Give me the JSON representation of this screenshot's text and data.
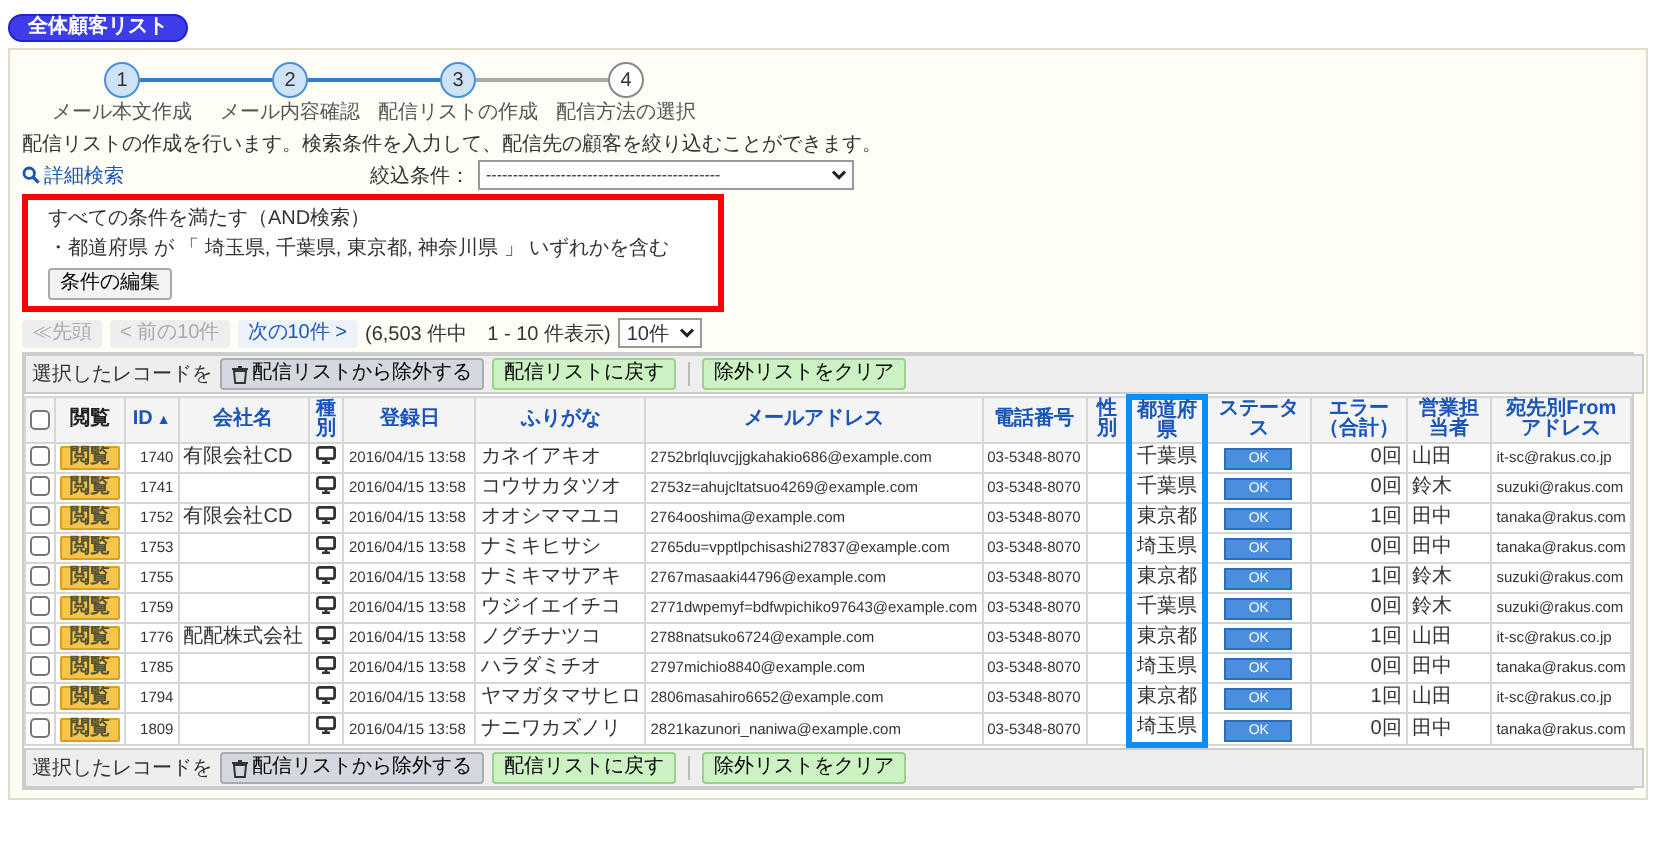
{
  "title": "全体顧客リスト",
  "steps": [
    {
      "number": "1",
      "label": "メール本文作成",
      "reached": true
    },
    {
      "number": "2",
      "label": "メール内容確認",
      "reached": true
    },
    {
      "number": "3",
      "label": "配信リストの作成",
      "reached": true
    },
    {
      "number": "4",
      "label": "配信方法の選択",
      "reached": false
    }
  ],
  "description": "配信リストの作成を行います。検索条件を入力して、配信先の顧客を絞り込むことができます。",
  "advanced_search": "詳細検索",
  "filter": {
    "label": "絞込条件：",
    "value": "--------------------------------------------"
  },
  "condition_box": {
    "lines": [
      "すべての条件を満たす（AND検索）",
      "・都道府県 が 「 埼玉県, 千葉県, 東京都, 神奈川県 」 いずれかを含む"
    ],
    "button": "条件の編集"
  },
  "pager": {
    "buttons": [
      {
        "label": "≪先頭",
        "disabled": true
      },
      {
        "label": "< 前の10件",
        "disabled": true
      },
      {
        "label": "次の10件 >",
        "disabled": false
      }
    ],
    "summary": "(6,503 件中　1 - 10 件表示)",
    "per_page": "10件"
  },
  "toolbar_top": {
    "label": "選択したレコードを",
    "buttons": [
      {
        "kind": "remove",
        "label": "配信リストから除外する",
        "separator_before": false
      },
      {
        "kind": "action",
        "label": "配信リストに戻す",
        "separator_before": false
      },
      {
        "kind": "action",
        "label": "除外リストをクリア",
        "separator_before": true
      }
    ]
  },
  "columns": [
    {
      "kind": "checkbox",
      "checked": false
    },
    {
      "kind": "view",
      "label": "閲覧",
      "link": false,
      "highlighted": false
    },
    {
      "kind": "id",
      "label": "ID",
      "sort_indicator": "▲",
      "link": true,
      "highlighted": false
    },
    {
      "kind": "company",
      "label": "会社名",
      "link": true,
      "highlighted": false
    },
    {
      "kind": "type",
      "label": "種別",
      "link": true,
      "highlighted": false
    },
    {
      "kind": "date",
      "label": "登録日",
      "link": true,
      "highlighted": false
    },
    {
      "kind": "furigana",
      "label": "ふりがな",
      "link": true,
      "highlighted": false
    },
    {
      "kind": "email",
      "label": "メールアドレス",
      "link": true,
      "highlighted": false
    },
    {
      "kind": "phone",
      "label": "電話番号",
      "link": true,
      "highlighted": false
    },
    {
      "kind": "gender",
      "label": "性別",
      "link": true,
      "highlighted": false
    },
    {
      "kind": "pref",
      "label": "都道府県",
      "link": true,
      "highlighted": true
    },
    {
      "kind": "status",
      "label": "ステータス",
      "link": true,
      "highlighted": false
    },
    {
      "kind": "errors",
      "label": "エラー（合計）",
      "link": true,
      "highlighted": false
    },
    {
      "kind": "sales",
      "label": "営業担当者",
      "link": true,
      "highlighted": false
    },
    {
      "kind": "from",
      "label": "宛先別Fromアドレス",
      "link": true,
      "highlighted": false
    }
  ],
  "rows": [
    {
      "checked": false,
      "view": "閲覧",
      "id": "1740",
      "company": "有限会社CD",
      "date": "2016/04/15 13:58",
      "furigana": "カネイアキオ",
      "email": "2752brlqluvcjjgkahakio686@example.com",
      "phone": "03-5348-8070",
      "pref": "千葉県",
      "status": "OK",
      "errors": "0回",
      "sales": "山田",
      "from": "it-sc@rakus.co.jp"
    },
    {
      "checked": false,
      "view": "閲覧",
      "id": "1741",
      "date": "2016/04/15 13:58",
      "furigana": "コウサカタツオ",
      "email": "2753z=ahujcltatsuo4269@example.com",
      "phone": "03-5348-8070",
      "pref": "千葉県",
      "status": "OK",
      "errors": "0回",
      "sales": "鈴木",
      "from": "suzuki@rakus.com"
    },
    {
      "checked": false,
      "view": "閲覧",
      "id": "1752",
      "company": "有限会社CD",
      "date": "2016/04/15 13:58",
      "furigana": "オオシママユコ",
      "email": "2764ooshima@example.com",
      "phone": "03-5348-8070",
      "pref": "東京都",
      "status": "OK",
      "errors": "1回",
      "sales": "田中",
      "from": "tanaka@rakus.com"
    },
    {
      "checked": false,
      "view": "閲覧",
      "id": "1753",
      "date": "2016/04/15 13:58",
      "furigana": "ナミキヒサシ",
      "email": "2765du=vpptlpchisashi27837@example.com",
      "phone": "03-5348-8070",
      "pref": "埼玉県",
      "status": "OK",
      "errors": "0回",
      "sales": "田中",
      "from": "tanaka@rakus.com"
    },
    {
      "checked": false,
      "view": "閲覧",
      "id": "1755",
      "date": "2016/04/15 13:58",
      "furigana": "ナミキマサアキ",
      "email": "2767masaaki44796@example.com",
      "phone": "03-5348-8070",
      "pref": "東京都",
      "status": "OK",
      "errors": "1回",
      "sales": "鈴木",
      "from": "suzuki@rakus.com"
    },
    {
      "checked": false,
      "view": "閲覧",
      "id": "1759",
      "date": "2016/04/15 13:58",
      "furigana": "ウジイエイチコ",
      "email": "2771dwpemyf=bdfwpichiko97643@example.com",
      "phone": "03-5348-8070",
      "pref": "千葉県",
      "status": "OK",
      "errors": "0回",
      "sales": "鈴木",
      "from": "suzuki@rakus.com"
    },
    {
      "checked": false,
      "view": "閲覧",
      "id": "1776",
      "company": "配配株式会社",
      "date": "2016/04/15 13:58",
      "furigana": "ノグチナツコ",
      "email": "2788natsuko6724@example.com",
      "phone": "03-5348-8070",
      "pref": "東京都",
      "status": "OK",
      "errors": "1回",
      "sales": "山田",
      "from": "it-sc@rakus.co.jp"
    },
    {
      "checked": false,
      "view": "閲覧",
      "id": "1785",
      "date": "2016/04/15 13:58",
      "furigana": "ハラダミチオ",
      "email": "2797michio8840@example.com",
      "phone": "03-5348-8070",
      "pref": "埼玉県",
      "status": "OK",
      "errors": "0回",
      "sales": "田中",
      "from": "tanaka@rakus.com"
    },
    {
      "checked": false,
      "view": "閲覧",
      "id": "1794",
      "date": "2016/04/15 13:58",
      "furigana": "ヤマガタマサヒロ",
      "email": "2806masahiro6652@example.com",
      "phone": "03-5348-8070",
      "pref": "東京都",
      "status": "OK",
      "errors": "1回",
      "sales": "山田",
      "from": "it-sc@rakus.co.jp"
    },
    {
      "checked": false,
      "view": "閲覧",
      "id": "1809",
      "date": "2016/04/15 13:58",
      "furigana": "ナニワカズノリ",
      "email": "2821kazunori_naniwa@example.com",
      "phone": "03-5348-8070",
      "pref": "埼玉県",
      "status": "OK",
      "errors": "0回",
      "sales": "田中",
      "from": "tanaka@rakus.com"
    }
  ],
  "toolbar_bottom": {
    "label": "選択したレコードを",
    "buttons": [
      {
        "kind": "remove",
        "label": "配信リストから除外する",
        "separator_before": false
      },
      {
        "kind": "action",
        "label": "配信リストに戻す",
        "separator_before": false
      },
      {
        "kind": "action",
        "label": "除外リストをクリア",
        "separator_before": true
      }
    ]
  }
}
